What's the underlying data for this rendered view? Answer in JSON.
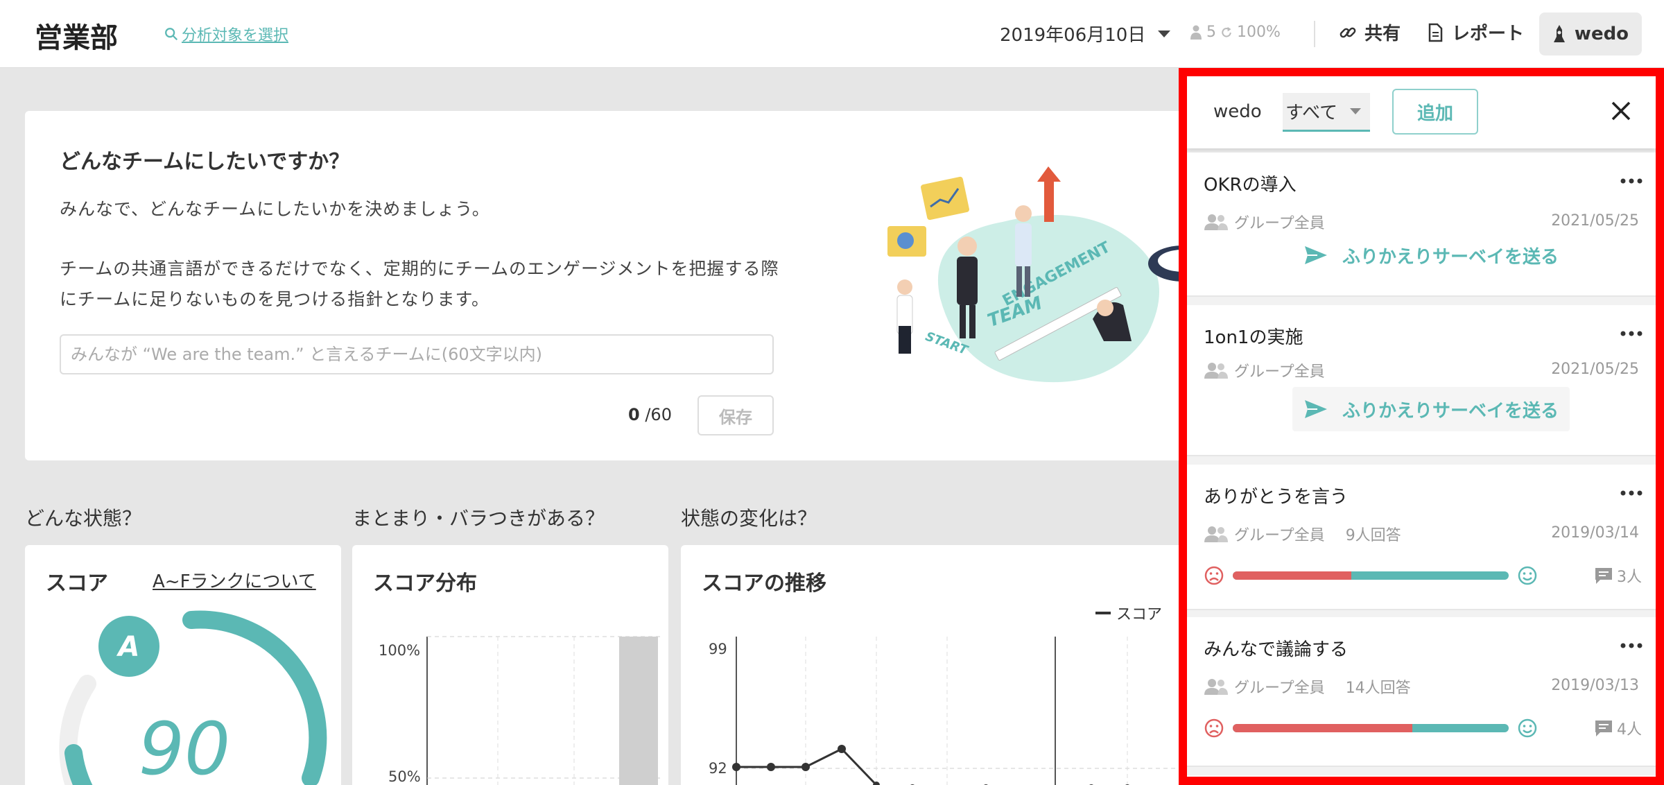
{
  "header": {
    "dept": "営業部",
    "select_target": "分析対象を選択",
    "date": "2019年06月10日",
    "member_count": "5",
    "rate": "100%",
    "share": "共有",
    "report": "レポート",
    "user": "wedo"
  },
  "goal": {
    "question": "どんなチームにしたいですか？",
    "desc1": "みんなで、どんなチームにしたいかを決めましょう。",
    "desc2": "チームの共通言語ができるだけでなく、定期的にチームのエンゲージメントを把握する際にチームに足りないものを見つける指針となります。",
    "placeholder": "みんなが “We are the team.” と言えるチームに(60文字以内)",
    "count": "0",
    "max": "/60",
    "save": "保存"
  },
  "illustration": {
    "engagement": "ENGAGEMENT",
    "team": "TEAM",
    "start": "START"
  },
  "sections": {
    "state": "どんな状態？",
    "spread": "まとまり・バラつきがある？",
    "change": "状態の変化は？"
  },
  "score_card": {
    "title": "スコア",
    "rank_link": "A~Fランクについて",
    "rank": "A",
    "score": "90"
  },
  "dist_card": {
    "title": "スコア分布",
    "tick_100": "100%",
    "tick_50": "50%"
  },
  "trend_card": {
    "title": "スコアの推移",
    "legend": "スコア",
    "tick_99": "99",
    "tick_92": "92"
  },
  "panel": {
    "user": "wedo",
    "filter": "すべて",
    "add": "追加",
    "items": [
      {
        "title": "OKRの導入",
        "group": "グループ全員",
        "date": "2021/05/25",
        "send": "ふりかえりサーベイを送る"
      },
      {
        "title": "1on1の実施",
        "group": "グループ全員",
        "date": "2021/05/25",
        "send": "ふりかえりサーベイを送る"
      },
      {
        "title": "ありがとうを言う",
        "group": "グループ全員",
        "answers": "9人回答",
        "date": "2019/03/14",
        "negative_share": 0.43,
        "comments": "3人"
      },
      {
        "title": "みんなで議論する",
        "group": "グループ全員",
        "answers": "14人回答",
        "date": "2019/03/13",
        "negative_share": 0.65,
        "comments": "4人"
      }
    ]
  },
  "colors": {
    "accent": "#5bb8b4",
    "negative": "#e06060",
    "highlight_border": "#ff0000"
  }
}
